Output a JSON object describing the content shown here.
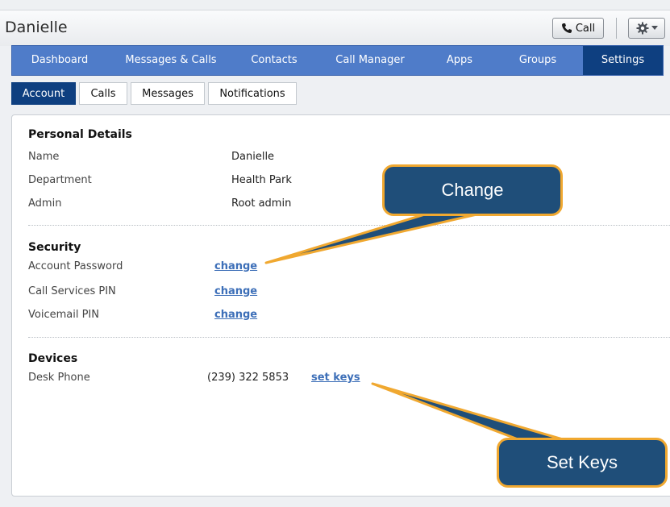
{
  "header": {
    "user_name": "Danielle",
    "call_label": "Call",
    "call_icon": "phone-icon",
    "settings_icon": "gear-icon"
  },
  "nav": {
    "items": [
      {
        "label": "Dashboard",
        "active": false
      },
      {
        "label": "Messages & Calls",
        "active": false
      },
      {
        "label": "Contacts",
        "active": false
      },
      {
        "label": "Call Manager",
        "active": false
      },
      {
        "label": "Apps",
        "active": false
      },
      {
        "label": "Groups",
        "active": false
      },
      {
        "label": "Settings",
        "active": true
      }
    ]
  },
  "subtabs": {
    "items": [
      {
        "label": "Account",
        "active": true
      },
      {
        "label": "Calls",
        "active": false
      },
      {
        "label": "Messages",
        "active": false
      },
      {
        "label": "Notifications",
        "active": false
      }
    ]
  },
  "personal": {
    "title": "Personal Details",
    "name_label": "Name",
    "name_value": "Danielle",
    "department_label": "Department",
    "department_value": "Health Park",
    "admin_label": "Admin",
    "admin_value": "Root admin"
  },
  "security": {
    "title": "Security",
    "account_password_label": "Account Password",
    "call_services_pin_label": "Call Services PIN",
    "voicemail_pin_label": "Voicemail PIN",
    "change_link": "change"
  },
  "devices": {
    "title": "Devices",
    "desk_phone_label": "Desk Phone",
    "desk_phone_number": "(239) 322 5853",
    "set_keys_link": "set keys"
  },
  "callouts": {
    "change": "Change",
    "set_keys": "Set Keys"
  },
  "colors": {
    "nav_bg": "#4f7cc9",
    "nav_active": "#0e3f80",
    "link": "#3d6fb8",
    "callout_fill": "#1f4e79",
    "callout_border": "#f0a830"
  }
}
